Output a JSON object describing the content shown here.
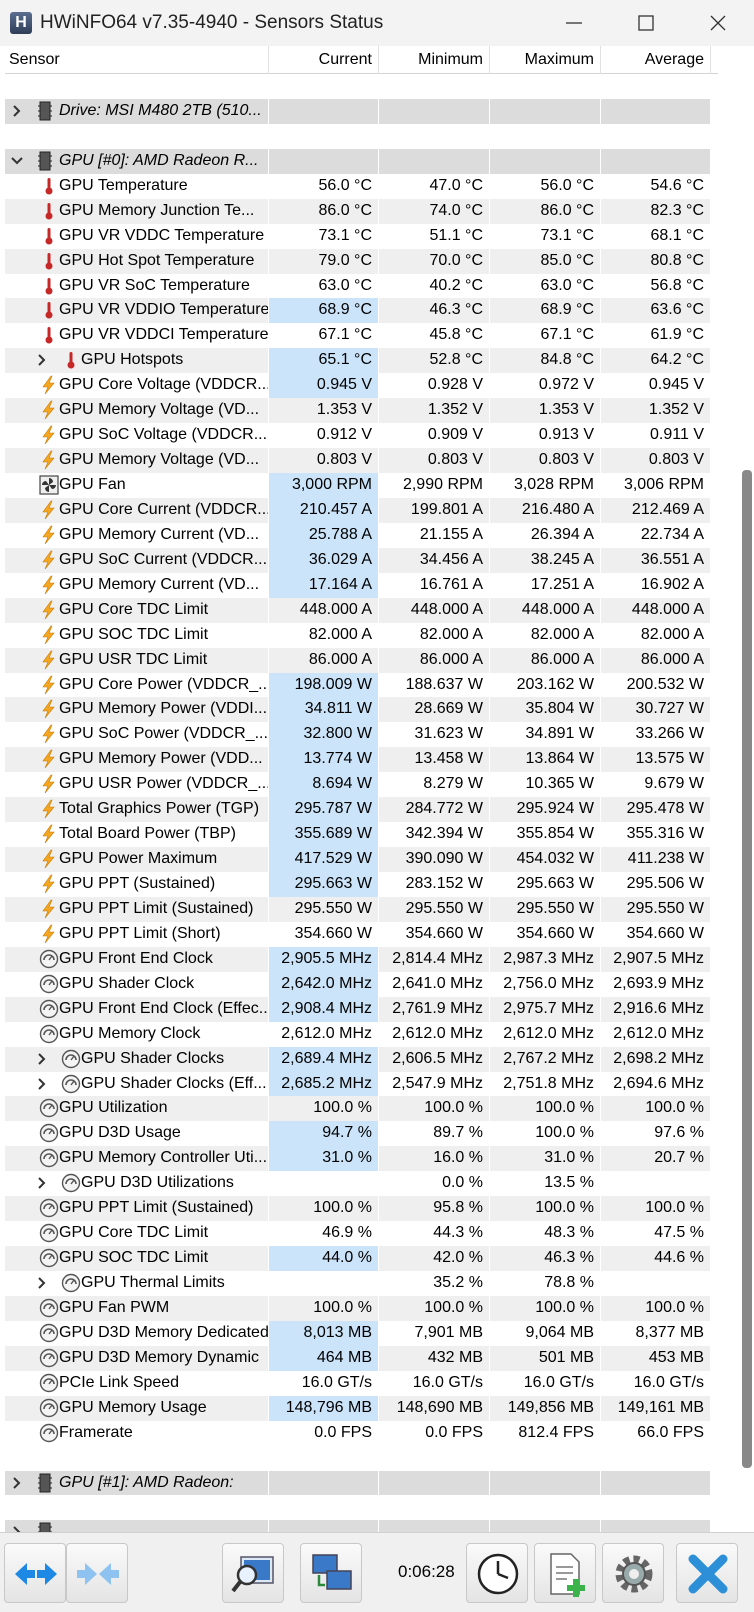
{
  "window": {
    "title": "HWiNFO64 v7.35-4940 - Sensors Status"
  },
  "columns": [
    "Sensor",
    "Current",
    "Minimum",
    "Maximum",
    "Average"
  ],
  "rows": [
    {
      "type": "empty"
    },
    {
      "type": "group",
      "name": "Drive: MSI M480 2TB (510...",
      "expanded": false
    },
    {
      "type": "empty"
    },
    {
      "type": "group",
      "name": "GPU [#0]: AMD Radeon R...",
      "expanded": true
    },
    {
      "name": "GPU Temperature",
      "icon": "thermometer-icon",
      "vals": [
        "56.0 °C",
        "47.0 °C",
        "56.0 °C",
        "54.6 °C"
      ]
    },
    {
      "name": "GPU Memory Junction Te...",
      "icon": "thermometer-icon",
      "vals": [
        "86.0 °C",
        "74.0 °C",
        "86.0 °C",
        "82.3 °C"
      ]
    },
    {
      "name": "GPU VR VDDC Temperature",
      "icon": "thermometer-icon",
      "vals": [
        "73.1 °C",
        "51.1 °C",
        "73.1 °C",
        "68.1 °C"
      ]
    },
    {
      "name": "GPU Hot Spot Temperature",
      "icon": "thermometer-icon",
      "vals": [
        "79.0 °C",
        "70.0 °C",
        "85.0 °C",
        "80.8 °C"
      ]
    },
    {
      "name": "GPU VR SoC Temperature",
      "icon": "thermometer-icon",
      "vals": [
        "63.0 °C",
        "40.2 °C",
        "63.0 °C",
        "56.8 °C"
      ]
    },
    {
      "name": "GPU VR VDDIO Temperature",
      "icon": "thermometer-icon",
      "vals": [
        "68.9 °C",
        "46.3 °C",
        "68.9 °C",
        "63.6 °C"
      ],
      "hl": true
    },
    {
      "name": "GPU VR VDDCI Temperature",
      "icon": "thermometer-icon",
      "vals": [
        "67.1 °C",
        "45.8 °C",
        "67.1 °C",
        "61.9 °C"
      ]
    },
    {
      "name": "GPU Hotspots",
      "icon": "thermometer-icon",
      "vals": [
        "65.1 °C",
        "52.8 °C",
        "84.8 °C",
        "64.2 °C"
      ],
      "hl": true,
      "sub": true
    },
    {
      "name": "GPU Core Voltage (VDDCR...",
      "icon": "bolt-icon",
      "vals": [
        "0.945 V",
        "0.928 V",
        "0.972 V",
        "0.945 V"
      ],
      "hl": true
    },
    {
      "name": "GPU Memory Voltage (VD...",
      "icon": "bolt-icon",
      "vals": [
        "1.353 V",
        "1.352 V",
        "1.353 V",
        "1.352 V"
      ]
    },
    {
      "name": "GPU SoC Voltage (VDDCR...",
      "icon": "bolt-icon",
      "vals": [
        "0.912 V",
        "0.909 V",
        "0.913 V",
        "0.911 V"
      ]
    },
    {
      "name": "GPU Memory Voltage (VD...",
      "icon": "bolt-icon",
      "vals": [
        "0.803 V",
        "0.803 V",
        "0.803 V",
        "0.803 V"
      ]
    },
    {
      "name": "GPU Fan",
      "icon": "fan-icon",
      "vals": [
        "3,000 RPM",
        "2,990 RPM",
        "3,028 RPM",
        "3,006 RPM"
      ],
      "hl": true
    },
    {
      "name": "GPU Core Current (VDDCR...",
      "icon": "bolt-icon",
      "vals": [
        "210.457 A",
        "199.801 A",
        "216.480 A",
        "212.469 A"
      ],
      "hl": true
    },
    {
      "name": "GPU Memory Current (VD...",
      "icon": "bolt-icon",
      "vals": [
        "25.788 A",
        "21.155 A",
        "26.394 A",
        "22.734 A"
      ],
      "hl": true
    },
    {
      "name": "GPU SoC Current (VDDCR...",
      "icon": "bolt-icon",
      "vals": [
        "36.029 A",
        "34.456 A",
        "38.245 A",
        "36.551 A"
      ],
      "hl": true
    },
    {
      "name": "GPU Memory Current (VD...",
      "icon": "bolt-icon",
      "vals": [
        "17.164 A",
        "16.761 A",
        "17.251 A",
        "16.902 A"
      ],
      "hl": true
    },
    {
      "name": "GPU Core TDC Limit",
      "icon": "bolt-icon",
      "vals": [
        "448.000 A",
        "448.000 A",
        "448.000 A",
        "448.000 A"
      ]
    },
    {
      "name": "GPU SOC TDC Limit",
      "icon": "bolt-icon",
      "vals": [
        "82.000 A",
        "82.000 A",
        "82.000 A",
        "82.000 A"
      ]
    },
    {
      "name": "GPU USR TDC Limit",
      "icon": "bolt-icon",
      "vals": [
        "86.000 A",
        "86.000 A",
        "86.000 A",
        "86.000 A"
      ]
    },
    {
      "name": "GPU Core Power (VDDCR_...",
      "icon": "bolt-icon",
      "vals": [
        "198.009 W",
        "188.637 W",
        "203.162 W",
        "200.532 W"
      ],
      "hl": true
    },
    {
      "name": "GPU Memory Power (VDDI...",
      "icon": "bolt-icon",
      "vals": [
        "34.811 W",
        "28.669 W",
        "35.804 W",
        "30.727 W"
      ],
      "hl": true
    },
    {
      "name": "GPU SoC Power (VDDCR_...",
      "icon": "bolt-icon",
      "vals": [
        "32.800 W",
        "31.623 W",
        "34.891 W",
        "33.266 W"
      ],
      "hl": true
    },
    {
      "name": "GPU Memory Power (VDD...",
      "icon": "bolt-icon",
      "vals": [
        "13.774 W",
        "13.458 W",
        "13.864 W",
        "13.575 W"
      ],
      "hl": true
    },
    {
      "name": "GPU USR Power (VDDCR_...",
      "icon": "bolt-icon",
      "vals": [
        "8.694 W",
        "8.279 W",
        "10.365 W",
        "9.679 W"
      ],
      "hl": true
    },
    {
      "name": "Total Graphics Power (TGP)",
      "icon": "bolt-icon",
      "vals": [
        "295.787 W",
        "284.772 W",
        "295.924 W",
        "295.478 W"
      ],
      "hl": true
    },
    {
      "name": "Total Board Power (TBP)",
      "icon": "bolt-icon",
      "vals": [
        "355.689 W",
        "342.394 W",
        "355.854 W",
        "355.316 W"
      ],
      "hl": true
    },
    {
      "name": "GPU Power Maximum",
      "icon": "bolt-icon",
      "vals": [
        "417.529 W",
        "390.090 W",
        "454.032 W",
        "411.238 W"
      ],
      "hl": true
    },
    {
      "name": "GPU PPT (Sustained)",
      "icon": "bolt-icon",
      "vals": [
        "295.663 W",
        "283.152 W",
        "295.663 W",
        "295.506 W"
      ],
      "hl": true
    },
    {
      "name": "GPU PPT Limit (Sustained)",
      "icon": "bolt-icon",
      "vals": [
        "295.550 W",
        "295.550 W",
        "295.550 W",
        "295.550 W"
      ]
    },
    {
      "name": "GPU PPT Limit (Short)",
      "icon": "bolt-icon",
      "vals": [
        "354.660 W",
        "354.660 W",
        "354.660 W",
        "354.660 W"
      ]
    },
    {
      "name": "GPU Front End Clock",
      "icon": "gauge-icon",
      "vals": [
        "2,905.5 MHz",
        "2,814.4 MHz",
        "2,987.3 MHz",
        "2,907.5 MHz"
      ],
      "hl": true
    },
    {
      "name": "GPU Shader Clock",
      "icon": "gauge-icon",
      "vals": [
        "2,642.0 MHz",
        "2,641.0 MHz",
        "2,756.0 MHz",
        "2,693.9 MHz"
      ],
      "hl": true
    },
    {
      "name": "GPU Front End Clock (Effec...",
      "icon": "gauge-icon",
      "vals": [
        "2,908.4 MHz",
        "2,761.9 MHz",
        "2,975.7 MHz",
        "2,916.6 MHz"
      ],
      "hl": true
    },
    {
      "name": "GPU Memory Clock",
      "icon": "gauge-icon",
      "vals": [
        "2,612.0 MHz",
        "2,612.0 MHz",
        "2,612.0 MHz",
        "2,612.0 MHz"
      ]
    },
    {
      "name": "GPU Shader Clocks",
      "icon": "gauge-icon",
      "vals": [
        "2,689.4 MHz",
        "2,606.5 MHz",
        "2,767.2 MHz",
        "2,698.2 MHz"
      ],
      "hl": true,
      "sub": true
    },
    {
      "name": "GPU Shader Clocks (Eff...",
      "icon": "gauge-icon",
      "vals": [
        "2,685.2 MHz",
        "2,547.9 MHz",
        "2,751.8 MHz",
        "2,694.6 MHz"
      ],
      "hl": true,
      "sub": true
    },
    {
      "name": "GPU Utilization",
      "icon": "gauge-icon",
      "vals": [
        "100.0 %",
        "100.0 %",
        "100.0 %",
        "100.0 %"
      ]
    },
    {
      "name": "GPU D3D Usage",
      "icon": "gauge-icon",
      "vals": [
        "94.7 %",
        "89.7 %",
        "100.0 %",
        "97.6 %"
      ],
      "hl": true
    },
    {
      "name": "GPU Memory Controller Uti...",
      "icon": "gauge-icon",
      "vals": [
        "31.0 %",
        "16.0 %",
        "31.0 %",
        "20.7 %"
      ],
      "hl": true
    },
    {
      "name": "GPU D3D Utilizations",
      "icon": "gauge-icon",
      "vals": [
        "",
        "0.0 %",
        "13.5 %",
        ""
      ],
      "sub": true
    },
    {
      "name": "GPU PPT Limit (Sustained)",
      "icon": "gauge-icon",
      "vals": [
        "100.0 %",
        "95.8 %",
        "100.0 %",
        "100.0 %"
      ]
    },
    {
      "name": "GPU Core TDC Limit",
      "icon": "gauge-icon",
      "vals": [
        "46.9 %",
        "44.3 %",
        "48.3 %",
        "47.5 %"
      ]
    },
    {
      "name": "GPU SOC TDC Limit",
      "icon": "gauge-icon",
      "vals": [
        "44.0 %",
        "42.0 %",
        "46.3 %",
        "44.6 %"
      ],
      "hl": true
    },
    {
      "name": "GPU Thermal Limits",
      "icon": "gauge-icon",
      "vals": [
        "",
        "35.2 %",
        "78.8 %",
        ""
      ],
      "sub": true
    },
    {
      "name": "GPU Fan PWM",
      "icon": "gauge-icon",
      "vals": [
        "100.0 %",
        "100.0 %",
        "100.0 %",
        "100.0 %"
      ]
    },
    {
      "name": "GPU D3D Memory Dedicated",
      "icon": "gauge-icon",
      "vals": [
        "8,013 MB",
        "7,901 MB",
        "9,064 MB",
        "8,377 MB"
      ],
      "hl": true
    },
    {
      "name": "GPU D3D Memory Dynamic",
      "icon": "gauge-icon",
      "vals": [
        "464 MB",
        "432 MB",
        "501 MB",
        "453 MB"
      ],
      "hl": true
    },
    {
      "name": "PCIe Link Speed",
      "icon": "gauge-icon",
      "vals": [
        "16.0 GT/s",
        "16.0 GT/s",
        "16.0 GT/s",
        "16.0 GT/s"
      ]
    },
    {
      "name": "GPU Memory Usage",
      "icon": "gauge-icon",
      "vals": [
        "148,796 MB",
        "148,690 MB",
        "149,856 MB",
        "149,161 MB"
      ],
      "hl": true
    },
    {
      "name": "Framerate",
      "icon": "gauge-icon",
      "vals": [
        "0.0 FPS",
        "0.0 FPS",
        "812.4 FPS",
        "66.0 FPS"
      ]
    },
    {
      "type": "empty"
    },
    {
      "type": "group",
      "name": "GPU [#1]: AMD Radeon:",
      "expanded": false
    },
    {
      "type": "empty"
    },
    {
      "type": "group",
      "name": "",
      "expanded": false
    }
  ],
  "toolbar": {
    "timer": "0:06:28",
    "buttons": [
      "nav-left-right-icon",
      "nav-collapse-icon",
      "sensor-search-icon",
      "network-monitor-icon",
      "clock-icon",
      "report-add-icon",
      "settings-gear-icon",
      "close-x-icon"
    ]
  },
  "colors": {
    "highlight": "#cce4f9",
    "group_bg": "#dcdcdc",
    "alt_row": "#efefef",
    "bolt": "#f5a623",
    "thermometer": "#c62828",
    "accent_blue": "#1e88e5"
  }
}
